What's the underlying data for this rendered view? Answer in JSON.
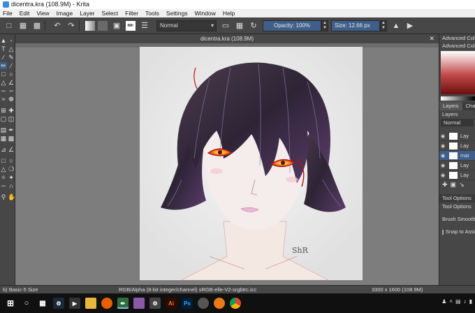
{
  "window": {
    "title": "dicentra.kra (108.9M) - Krita"
  },
  "menu": [
    "File",
    "Edit",
    "View",
    "Image",
    "Layer",
    "Select",
    "Filter",
    "Tools",
    "Settings",
    "Window",
    "Help"
  ],
  "toolbar": {
    "blend_mode": "Normal",
    "opacity_label": "Opacity:  100%",
    "size_label": "Size:  12.66 px"
  },
  "document": {
    "tab_title": "dicentra.kra (108.9M)"
  },
  "artwork": {
    "signature": "ShR"
  },
  "dock": {
    "color_panel_title": "Advanced Color",
    "color_panel_subtitle": "Advanced Color S",
    "tabs": [
      "Layers",
      "Chan"
    ],
    "layers_title": "Layers",
    "layer_blend_mode": "Normal",
    "layers": [
      {
        "name": "Lay",
        "selected": false
      },
      {
        "name": "Lay",
        "selected": false
      },
      {
        "name": "mar",
        "selected": true
      },
      {
        "name": "Lay",
        "selected": false
      },
      {
        "name": "Lay",
        "selected": false
      }
    ],
    "tool_options_tab": "Tool Options",
    "tool_options_title": "Tool Options",
    "brush_smoothing_label": "Brush Smoothing",
    "snap_label": "Snap to Assist"
  },
  "status": {
    "brush": "b) Basic-5 Size",
    "color_space": "RGB/Alpha (8-bit integer/channel)  sRGB-elle-V2-srgbtrc.icc",
    "dimensions": "3300 x 1600 (108.9M)"
  },
  "colors": {
    "accent": "#3f5f8a",
    "panel": "#474747",
    "canvas_bg": "#7d7d7d"
  }
}
